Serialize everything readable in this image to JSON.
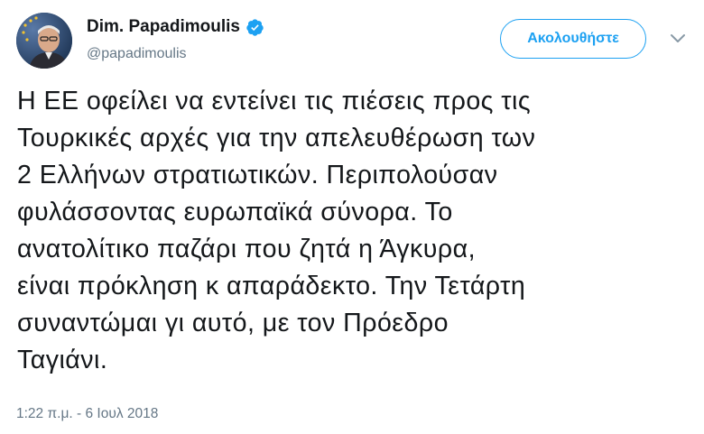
{
  "author": {
    "display_name": "Dim. Papadimoulis",
    "handle": "@papadimoulis",
    "verified": true
  },
  "follow_button": {
    "label": "Ακολουθήστε"
  },
  "tweet": {
    "text": "Η ΕΕ οφείλει να εντείνει τις πιέσεις προς τις\nΤουρκικές αρχές για την απελευθέρωση των\n2 Ελλήνων στρατιωτικών. Περιπολούσαν\nφυλάσσοντας ευρωπαϊκά σύνορα. Το\nανατολίτικο παζάρι που ζητά η Άγκυρα,\nείναι πρόκληση κ απαράδεκτο. Την Τετάρτη\nσυναντώμαι γι αυτό, με τον Πρόεδρο\nΤαγιάνι.",
    "timestamp": "1:22 π.μ. - 6 Ιουλ 2018"
  },
  "colors": {
    "accent": "#1da1f2",
    "text": "#14171a",
    "secondary": "#657786"
  },
  "icons": {
    "verified": "verified-badge-icon",
    "caret": "chevron-down-icon"
  }
}
